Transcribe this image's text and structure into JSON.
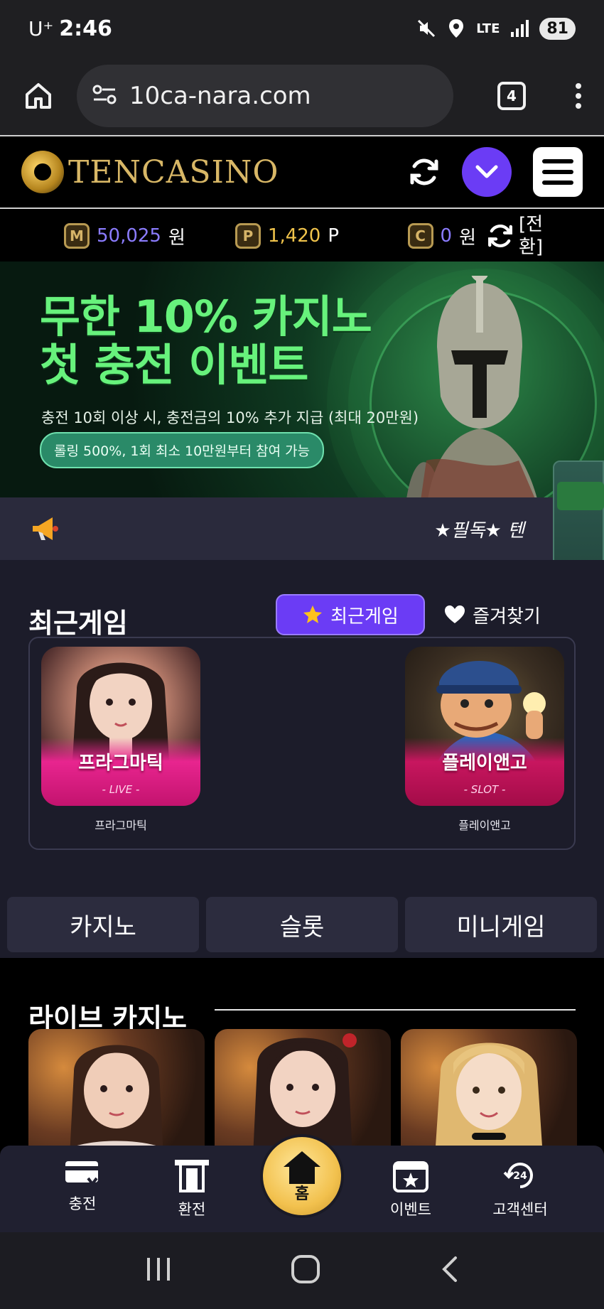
{
  "status_bar": {
    "carrier": "U⁺",
    "time": "2:46",
    "network": "LTE",
    "battery": "81"
  },
  "browser": {
    "url": "10ca-nara.com",
    "tab_count": "4"
  },
  "header": {
    "logo_text": "TENCASINO"
  },
  "balances": {
    "money": {
      "icon": "M",
      "value": "50,025",
      "unit": "원"
    },
    "points": {
      "icon": "P",
      "value": "1,420",
      "unit": "P"
    },
    "coin": {
      "icon": "C",
      "value": "0",
      "unit": "원"
    },
    "exchange_label": "[전환]"
  },
  "banner": {
    "title_line1": "무한 10% 카지노",
    "title_line2": "첫 충전 이벤트",
    "subtitle": "충전 10회 이상 시, 충전금의 10% 추가 지급 (최대 20만원)",
    "pill": "롤링 500%, 1회 최소 10만원부터 참여 가능"
  },
  "notice": {
    "text": "★필독★ 텐"
  },
  "recent_games": {
    "title": "최근게임",
    "toggle_recent": "최근게임",
    "toggle_favorites": "즐겨찾기",
    "items": [
      {
        "name": "프라그마틱",
        "tag": "- LIVE -",
        "caption": "프라그마틱"
      },
      {
        "name": "플레이앤고",
        "tag": "- SLOT -",
        "caption": "플레이앤고"
      }
    ]
  },
  "categories": [
    "카지노",
    "슬롯",
    "미니게임"
  ],
  "live_casino": {
    "title": "라이브 카지노"
  },
  "bottom_nav": {
    "charge": "충전",
    "exchange": "환전",
    "home": "홈",
    "event": "이벤트",
    "support": "고객센터"
  },
  "colors": {
    "accent_purple": "#6b3cf5",
    "banner_green": "#67f27c",
    "gold": "#f0c34b",
    "game_pink": "#e8258f"
  }
}
